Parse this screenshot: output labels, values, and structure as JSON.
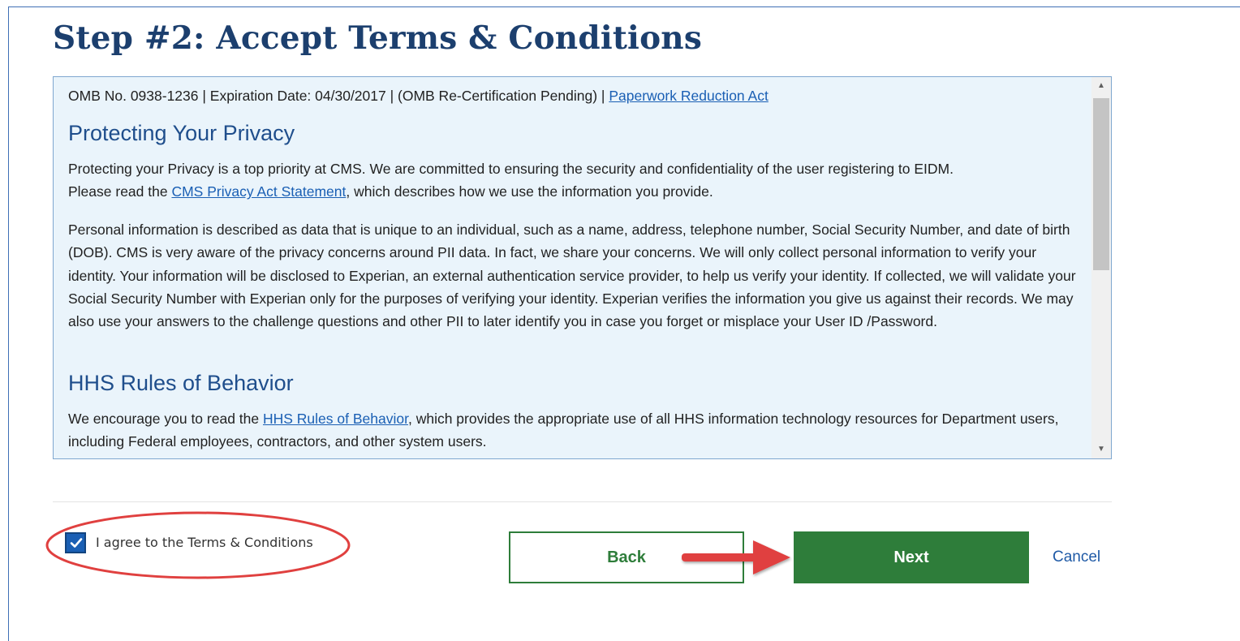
{
  "page": {
    "title": "Step #2: Accept Terms & Conditions"
  },
  "terms": {
    "omb_text": "OMB No. 0938-1236 | Expiration Date: 04/30/2017 | (OMB Re-Certification Pending) | ",
    "omb_link": "Paperwork Reduction Act",
    "privacy_heading": "Protecting Your Privacy",
    "privacy_p1_line1": "Protecting your Privacy is a top priority at CMS. We are committed to ensuring the security and confidentiality of the user registering to EIDM.",
    "privacy_p1_pre": "Please read the ",
    "privacy_p1_link": "CMS Privacy Act Statement",
    "privacy_p1_post": ", which describes how we use the information you provide.",
    "privacy_p2": "Personal information is described as data that is unique to an individual, such as a name, address, telephone number, Social Security Number, and date of birth (DOB). CMS is very aware of the privacy concerns around PII data. In fact, we share your concerns. We will only collect personal information to verify your identity. Your information will be disclosed to Experian, an external authentication service provider, to help us verify your identity. If collected, we will validate your Social Security Number with Experian only for the purposes of verifying your identity. Experian verifies the information you give us against their records. We may also use your answers to the challenge questions and other PII to later identify you in case you forget or misplace your User ID /Password.",
    "hhs_heading": "HHS Rules of Behavior",
    "hhs_pre": "We encourage you to read the ",
    "hhs_link": "HHS Rules of Behavior",
    "hhs_post": ", which provides the appropriate use of all HHS information technology resources for Department users, including Federal employees, contractors, and other system users."
  },
  "agree": {
    "label": "I agree to the Terms & Conditions",
    "checked": true
  },
  "buttons": {
    "back": "Back",
    "next": "Next",
    "cancel": "Cancel"
  },
  "colors": {
    "title": "#1c3f6e",
    "heading": "#1f4e8c",
    "link": "#1a5fb4",
    "button_green": "#2e7d3a",
    "annotation_red": "#e0403f",
    "box_bg": "#eaf4fb"
  }
}
